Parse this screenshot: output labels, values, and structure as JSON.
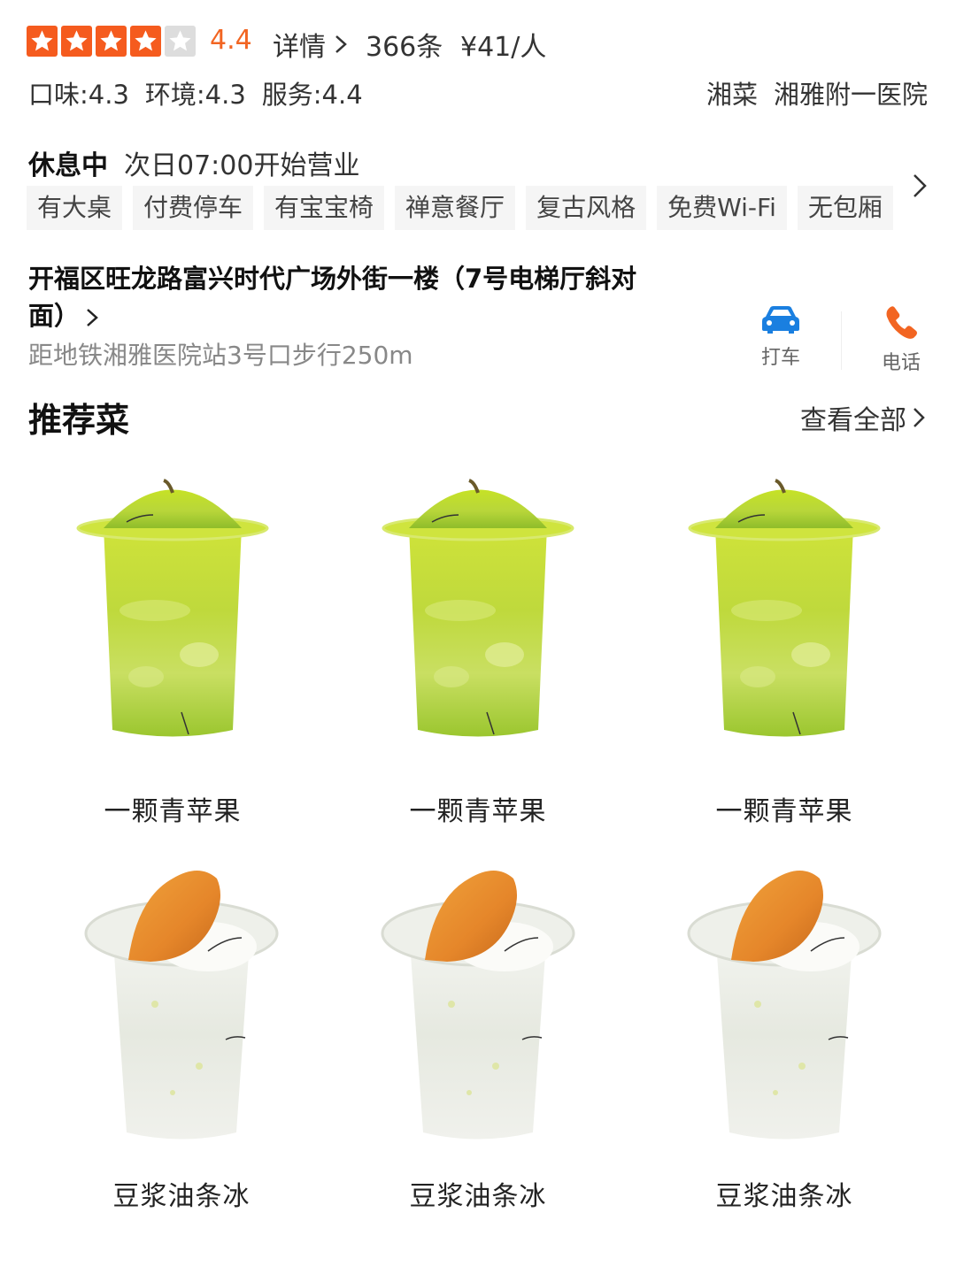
{
  "rating": {
    "stars_filled": 4,
    "stars_total": 5,
    "score": "4.4",
    "detail_label": "详情",
    "review_count": "366条",
    "price": "¥41/人"
  },
  "scores": [
    "口味:4.3",
    "环境:4.3",
    "服务:4.4"
  ],
  "categories": [
    "湘菜",
    "湘雅附一医院"
  ],
  "status": {
    "state": "休息中",
    "hours": "次日07:00开始营业"
  },
  "tags": [
    "有大桌",
    "付费停车",
    "有宝宝椅",
    "禅意餐厅",
    "复古风格",
    "免费Wi-Fi",
    "无包厢"
  ],
  "address": {
    "text": "开福区旺龙路富兴时代广场外街一楼（7号电梯厅斜对面）",
    "subway": "距地铁湘雅医院站3号口步行250m"
  },
  "actions": {
    "taxi_label": "打车",
    "call_label": "电话"
  },
  "colors": {
    "accent_orange": "#f26522",
    "star_orange": "#f55b1e",
    "taxi_blue": "#1a7fe0"
  },
  "recommend": {
    "title": "推荐菜",
    "view_all": "查看全部",
    "dishes": [
      {
        "name": "一颗青苹果",
        "image": "green-apple-drink"
      },
      {
        "name": "一颗青苹果",
        "image": "green-apple-drink"
      },
      {
        "name": "一颗青苹果",
        "image": "green-apple-drink"
      },
      {
        "name": "豆浆油条冰",
        "image": "soymilk-youtiao-ice"
      },
      {
        "name": "豆浆油条冰",
        "image": "soymilk-youtiao-ice"
      },
      {
        "name": "豆浆油条冰",
        "image": "soymilk-youtiao-ice"
      }
    ]
  }
}
